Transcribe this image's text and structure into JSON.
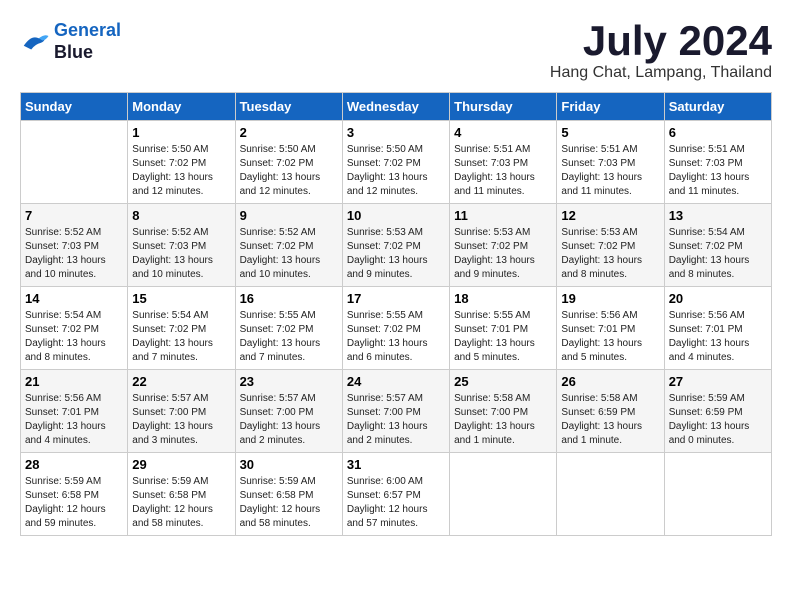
{
  "header": {
    "logo_line1": "General",
    "logo_line2": "Blue",
    "month_title": "July 2024",
    "location": "Hang Chat, Lampang, Thailand"
  },
  "days_of_week": [
    "Sunday",
    "Monday",
    "Tuesday",
    "Wednesday",
    "Thursday",
    "Friday",
    "Saturday"
  ],
  "weeks": [
    [
      {
        "day": "",
        "info": ""
      },
      {
        "day": "1",
        "info": "Sunrise: 5:50 AM\nSunset: 7:02 PM\nDaylight: 13 hours\nand 12 minutes."
      },
      {
        "day": "2",
        "info": "Sunrise: 5:50 AM\nSunset: 7:02 PM\nDaylight: 13 hours\nand 12 minutes."
      },
      {
        "day": "3",
        "info": "Sunrise: 5:50 AM\nSunset: 7:02 PM\nDaylight: 13 hours\nand 12 minutes."
      },
      {
        "day": "4",
        "info": "Sunrise: 5:51 AM\nSunset: 7:03 PM\nDaylight: 13 hours\nand 11 minutes."
      },
      {
        "day": "5",
        "info": "Sunrise: 5:51 AM\nSunset: 7:03 PM\nDaylight: 13 hours\nand 11 minutes."
      },
      {
        "day": "6",
        "info": "Sunrise: 5:51 AM\nSunset: 7:03 PM\nDaylight: 13 hours\nand 11 minutes."
      }
    ],
    [
      {
        "day": "7",
        "info": "Sunrise: 5:52 AM\nSunset: 7:03 PM\nDaylight: 13 hours\nand 10 minutes."
      },
      {
        "day": "8",
        "info": "Sunrise: 5:52 AM\nSunset: 7:03 PM\nDaylight: 13 hours\nand 10 minutes."
      },
      {
        "day": "9",
        "info": "Sunrise: 5:52 AM\nSunset: 7:02 PM\nDaylight: 13 hours\nand 10 minutes."
      },
      {
        "day": "10",
        "info": "Sunrise: 5:53 AM\nSunset: 7:02 PM\nDaylight: 13 hours\nand 9 minutes."
      },
      {
        "day": "11",
        "info": "Sunrise: 5:53 AM\nSunset: 7:02 PM\nDaylight: 13 hours\nand 9 minutes."
      },
      {
        "day": "12",
        "info": "Sunrise: 5:53 AM\nSunset: 7:02 PM\nDaylight: 13 hours\nand 8 minutes."
      },
      {
        "day": "13",
        "info": "Sunrise: 5:54 AM\nSunset: 7:02 PM\nDaylight: 13 hours\nand 8 minutes."
      }
    ],
    [
      {
        "day": "14",
        "info": "Sunrise: 5:54 AM\nSunset: 7:02 PM\nDaylight: 13 hours\nand 8 minutes."
      },
      {
        "day": "15",
        "info": "Sunrise: 5:54 AM\nSunset: 7:02 PM\nDaylight: 13 hours\nand 7 minutes."
      },
      {
        "day": "16",
        "info": "Sunrise: 5:55 AM\nSunset: 7:02 PM\nDaylight: 13 hours\nand 7 minutes."
      },
      {
        "day": "17",
        "info": "Sunrise: 5:55 AM\nSunset: 7:02 PM\nDaylight: 13 hours\nand 6 minutes."
      },
      {
        "day": "18",
        "info": "Sunrise: 5:55 AM\nSunset: 7:01 PM\nDaylight: 13 hours\nand 5 minutes."
      },
      {
        "day": "19",
        "info": "Sunrise: 5:56 AM\nSunset: 7:01 PM\nDaylight: 13 hours\nand 5 minutes."
      },
      {
        "day": "20",
        "info": "Sunrise: 5:56 AM\nSunset: 7:01 PM\nDaylight: 13 hours\nand 4 minutes."
      }
    ],
    [
      {
        "day": "21",
        "info": "Sunrise: 5:56 AM\nSunset: 7:01 PM\nDaylight: 13 hours\nand 4 minutes."
      },
      {
        "day": "22",
        "info": "Sunrise: 5:57 AM\nSunset: 7:00 PM\nDaylight: 13 hours\nand 3 minutes."
      },
      {
        "day": "23",
        "info": "Sunrise: 5:57 AM\nSunset: 7:00 PM\nDaylight: 13 hours\nand 2 minutes."
      },
      {
        "day": "24",
        "info": "Sunrise: 5:57 AM\nSunset: 7:00 PM\nDaylight: 13 hours\nand 2 minutes."
      },
      {
        "day": "25",
        "info": "Sunrise: 5:58 AM\nSunset: 7:00 PM\nDaylight: 13 hours\nand 1 minute."
      },
      {
        "day": "26",
        "info": "Sunrise: 5:58 AM\nSunset: 6:59 PM\nDaylight: 13 hours\nand 1 minute."
      },
      {
        "day": "27",
        "info": "Sunrise: 5:59 AM\nSunset: 6:59 PM\nDaylight: 13 hours\nand 0 minutes."
      }
    ],
    [
      {
        "day": "28",
        "info": "Sunrise: 5:59 AM\nSunset: 6:58 PM\nDaylight: 12 hours\nand 59 minutes."
      },
      {
        "day": "29",
        "info": "Sunrise: 5:59 AM\nSunset: 6:58 PM\nDaylight: 12 hours\nand 58 minutes."
      },
      {
        "day": "30",
        "info": "Sunrise: 5:59 AM\nSunset: 6:58 PM\nDaylight: 12 hours\nand 58 minutes."
      },
      {
        "day": "31",
        "info": "Sunrise: 6:00 AM\nSunset: 6:57 PM\nDaylight: 12 hours\nand 57 minutes."
      },
      {
        "day": "",
        "info": ""
      },
      {
        "day": "",
        "info": ""
      },
      {
        "day": "",
        "info": ""
      }
    ]
  ]
}
